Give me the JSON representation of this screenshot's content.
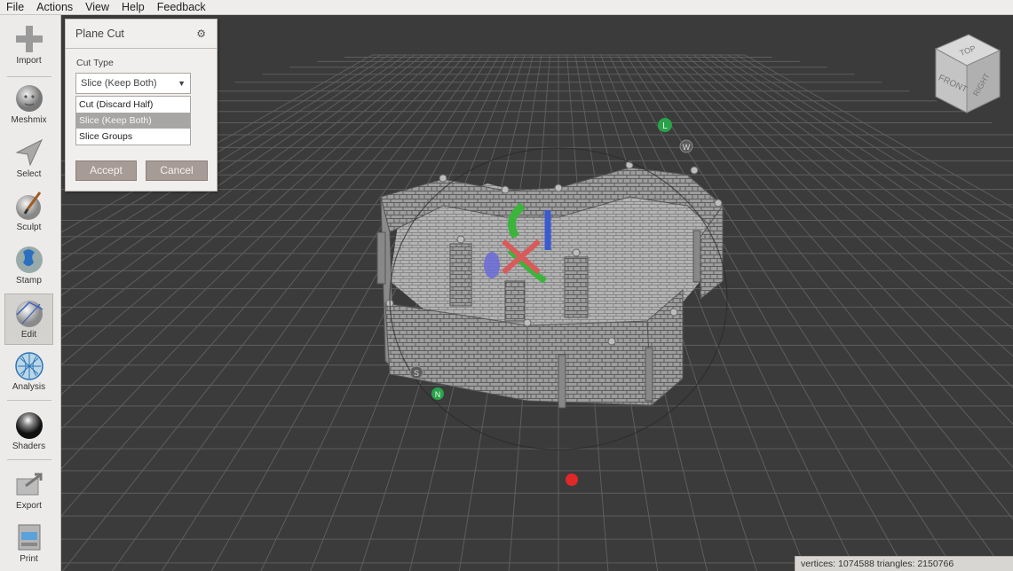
{
  "menu": [
    "File",
    "Actions",
    "View",
    "Help",
    "Feedback"
  ],
  "toolbar": [
    {
      "label": "Import",
      "icon": "plus-icon"
    },
    {
      "label": "Meshmix",
      "icon": "head-icon"
    },
    {
      "label": "Select",
      "icon": "arrow-icon"
    },
    {
      "label": "Sculpt",
      "icon": "brush-icon"
    },
    {
      "label": "Stamp",
      "icon": "stamp-icon"
    },
    {
      "label": "Edit",
      "icon": "edit-sphere-icon",
      "active": true
    },
    {
      "label": "Analysis",
      "icon": "mesh-sphere-icon"
    },
    {
      "label": "Shaders",
      "icon": "chrome-sphere-icon"
    },
    {
      "label": "Export",
      "icon": "export-icon"
    },
    {
      "label": "Print",
      "icon": "printer-icon"
    }
  ],
  "panel": {
    "title": "Plane Cut",
    "cut_type_label": "Cut Type",
    "selected": "Slice (Keep Both)",
    "options": [
      "Cut (Discard Half)",
      "Slice (Keep Both)",
      "Slice Groups"
    ],
    "accept": "Accept",
    "cancel": "Cancel"
  },
  "viewcube": {
    "top": "TOP",
    "front": "FRONT",
    "right": "RIGHT"
  },
  "gizmo": {
    "l": "L",
    "w": "W",
    "s": "S",
    "n": "N"
  },
  "status": "vertices: 1074588 triangles: 2150766",
  "colors": {
    "accent_button": "#a79b95",
    "viewport_bg": "#3b3b3b",
    "grid": "#5e5e5e"
  }
}
